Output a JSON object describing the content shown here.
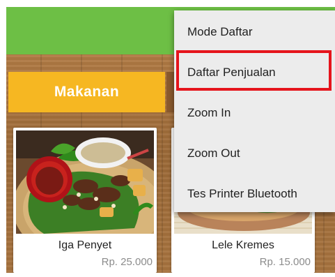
{
  "category_tab": {
    "label": "Makanan"
  },
  "products": [
    {
      "name": "Iga Penyet",
      "price": "Rp. 25.000"
    },
    {
      "name": "Lele Kremes",
      "price": "Rp. 15.000"
    }
  ],
  "overflow_menu": {
    "items": [
      {
        "label": "Mode Daftar"
      },
      {
        "label": "Daftar Penjualan",
        "highlighted": true
      },
      {
        "label": "Zoom In"
      },
      {
        "label": "Zoom Out"
      },
      {
        "label": "Tes Printer Bluetooth"
      }
    ]
  },
  "colors": {
    "appbar": "#6dbf45",
    "category_tab": "#f6b722",
    "menu_background": "#ececec",
    "highlight": "#e5141c"
  }
}
